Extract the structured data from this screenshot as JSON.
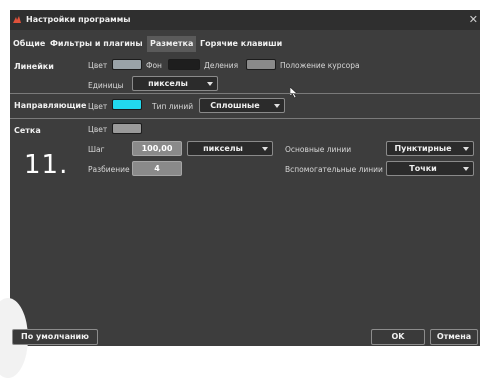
{
  "window": {
    "title": "Настройки программы",
    "close_glyph": "✕",
    "accent_color": "#e0523b"
  },
  "tabs": [
    {
      "label": "Общие",
      "active": false
    },
    {
      "label": "Фильтры и плагины",
      "active": false
    },
    {
      "label": "Разметка",
      "active": true
    },
    {
      "label": "Горячие клавиши",
      "active": false
    }
  ],
  "rulers": {
    "section_label": "Линейки",
    "color_label": "Цвет",
    "color_value": "#9aa3a8",
    "background_label": "Фон",
    "background_value": "#1e1e1e",
    "divisions_label": "Деления",
    "divisions_value": "#8a8a8a",
    "cursor_position_label": "Положение курсора",
    "units_label": "Единицы",
    "units_value": "пикселы"
  },
  "guides": {
    "section_label": "Направляющие",
    "color_label": "Цвет",
    "color_value": "#22d9ee",
    "line_type_label": "Тип линий",
    "line_type_value": "Сплошные"
  },
  "grid": {
    "section_label": "Сетка",
    "color_label": "Цвет",
    "color_value": "#9a9a9a",
    "step_label": "Шаг",
    "step_value": "100,00",
    "step_units_value": "пикселы",
    "subdivision_label": "Разбиение",
    "subdivision_value": "4",
    "main_lines_label": "Основные линии",
    "main_lines_value": "Пунктирные",
    "minor_lines_label": "Вспомогательные линии",
    "minor_lines_value": "Точки"
  },
  "overlay": {
    "step_number": "11."
  },
  "footer": {
    "defaults_label": "По умолчанию",
    "ok_label": "OK",
    "cancel_label": "Отмена"
  },
  "icons": [
    "app-logo-icon",
    "close-icon",
    "mouse-cursor-icon",
    "dropdown-arrow-icon"
  ]
}
